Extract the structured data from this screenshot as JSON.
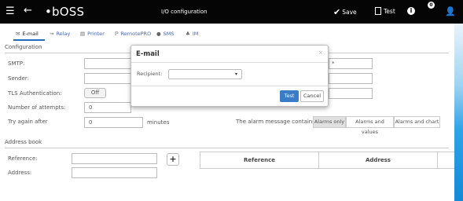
{
  "topbar": {
    "menu_icon": "hamburger-icon",
    "back_icon": "back-arrow-icon",
    "logo": "•bOSS",
    "title": "I/O configuration",
    "save_label": "Save",
    "test_label": "Test",
    "info_icon": "info-icon",
    "notification_count": "0",
    "user_icon": "user-icon"
  },
  "tabs": [
    {
      "label": "E-mail",
      "icon": "envelope-icon"
    },
    {
      "label": "Relay",
      "icon": "relay-icon"
    },
    {
      "label": "Printer",
      "icon": "printer-icon"
    },
    {
      "label": "RemotePRO",
      "icon": "remote-icon"
    },
    {
      "label": "SMS",
      "icon": "sms-icon"
    },
    {
      "label": "IM",
      "icon": "im-icon"
    }
  ],
  "config": {
    "section_title": "Configuration",
    "smtp_label": "SMTP:",
    "sender_label": "Sender:",
    "tls_label": "TLS Authentication:",
    "tls_value": "Off",
    "attempts_label": "Number of attempts:",
    "attempts_value": "0",
    "retry_label": "Try again after",
    "retry_value": "0",
    "retry_unit": "minutes",
    "alarm_label": "The alarm message contains:",
    "alarm_options": [
      "Alarms only",
      "Alarms and values",
      "Alarms and chart"
    ]
  },
  "addressbook": {
    "section_title": "Address book",
    "reference_label": "Reference:",
    "address_label": "Address:",
    "table_headers": [
      "Reference",
      "Address"
    ]
  },
  "modal": {
    "title": "E-mail",
    "close": "×",
    "recipient_label": "Recipient:",
    "recipient_value": "",
    "test_button": "Test",
    "cancel_button": "Cancel"
  }
}
